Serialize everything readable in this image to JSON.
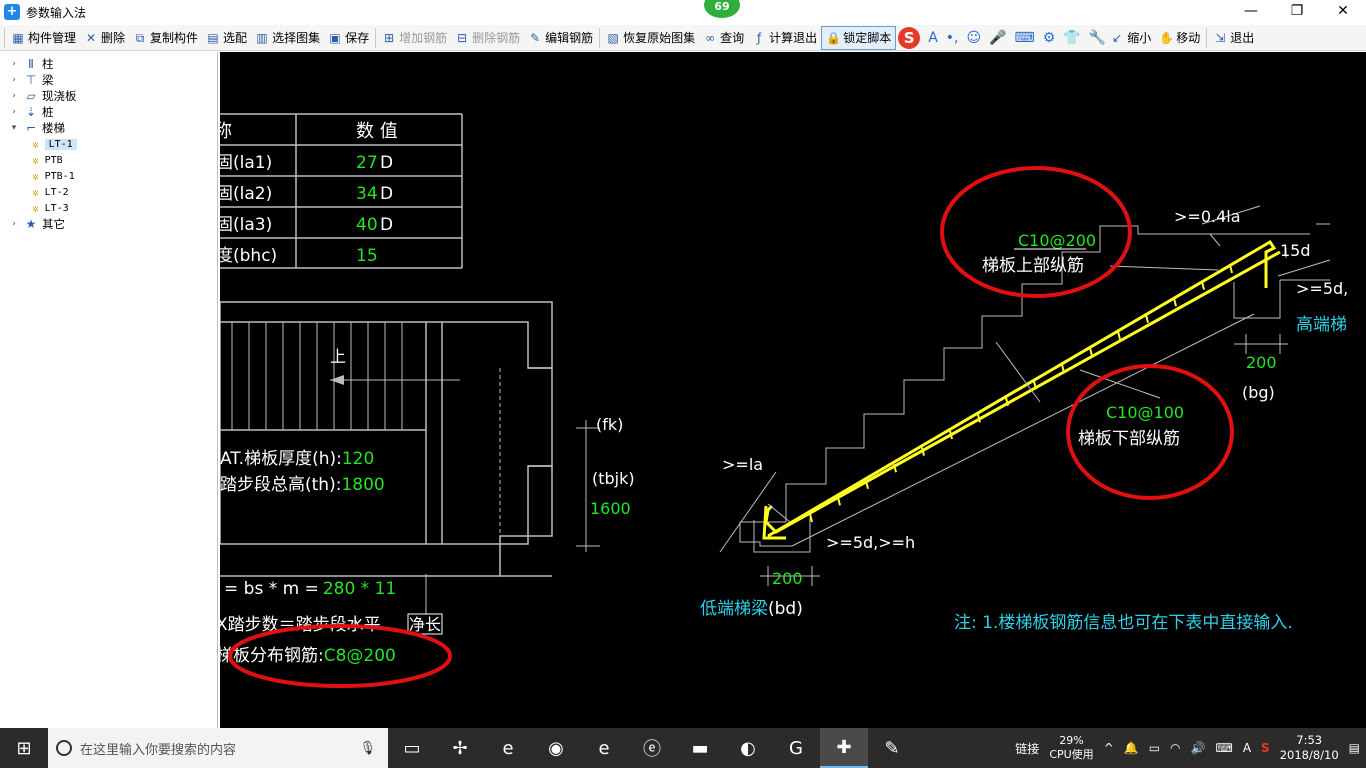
{
  "window": {
    "title": "参数输入法",
    "badge": "69",
    "controls": [
      "—",
      "❐",
      "✕"
    ]
  },
  "toolbar": {
    "items": [
      {
        "label": "构件管理",
        "icon": "table-icon",
        "glyph": "▦",
        "disabled": false
      },
      {
        "label": "删除",
        "icon": "delete-icon",
        "glyph": "✕",
        "disabled": false
      },
      {
        "label": "复制构件",
        "icon": "copy-icon",
        "glyph": "⧉",
        "disabled": false
      },
      {
        "label": "选配",
        "icon": "select-icon",
        "glyph": "▤",
        "disabled": false
      },
      {
        "label": "选择图集",
        "icon": "atlas-icon",
        "glyph": "▥",
        "disabled": false
      },
      {
        "label": "保存",
        "icon": "save-icon",
        "glyph": "▣",
        "disabled": false
      },
      {
        "label": "增加钢筋",
        "icon": "add-rebar-icon",
        "glyph": "⊞",
        "disabled": true
      },
      {
        "label": "删除钢筋",
        "icon": "delete-rebar-icon",
        "glyph": "⊟",
        "disabled": true
      },
      {
        "label": "编辑钢筋",
        "icon": "edit-rebar-icon",
        "glyph": "✎",
        "disabled": false
      },
      {
        "label": "恢复原始图集",
        "icon": "restore-icon",
        "glyph": "▧",
        "disabled": false
      },
      {
        "label": "查询",
        "icon": "binoculars-icon",
        "glyph": "∞",
        "disabled": false
      },
      {
        "label": "计算退出",
        "icon": "fx-icon",
        "glyph": "ƒ",
        "disabled": false
      },
      {
        "label": "锁定脚本",
        "icon": "lock-icon",
        "glyph": "🔒",
        "disabled": false,
        "locked": true
      }
    ],
    "right_items": [
      {
        "label": "缩小",
        "icon": "zoom-out-icon",
        "glyph": "↙"
      },
      {
        "label": "移动",
        "icon": "move-icon",
        "glyph": "✋"
      },
      {
        "label": "退出",
        "icon": "exit-icon",
        "glyph": "⇲"
      }
    ],
    "ime_icons": [
      "S",
      "A",
      "•,",
      "☺",
      "🎤",
      "⌨",
      "⚙",
      "👕",
      "🔧"
    ]
  },
  "tree": {
    "items": [
      {
        "label": "柱",
        "icon": "column-icon",
        "expanded": false
      },
      {
        "label": "梁",
        "icon": "beam-icon",
        "expanded": false
      },
      {
        "label": "现浇板",
        "icon": "slab-icon",
        "expanded": false
      },
      {
        "label": "桩",
        "icon": "pile-icon",
        "expanded": false
      },
      {
        "label": "楼梯",
        "icon": "stair-icon",
        "expanded": true,
        "children": [
          "LT-1",
          "PTB",
          "PTB-1",
          "LT-2",
          "LT-3"
        ],
        "selected": "LT-1"
      },
      {
        "label": "其它",
        "icon": "star-icon",
        "expanded": false
      }
    ]
  },
  "drawing": {
    "table": {
      "header": [
        "称",
        "数  值"
      ],
      "rows": [
        {
          "name": "固(la1)",
          "value": "27",
          "unit": "D"
        },
        {
          "name": "固(la2)",
          "value": "34",
          "unit": "D"
        },
        {
          "name": "固(la3)",
          "value": "40",
          "unit": "D"
        },
        {
          "name": "度(bhc)",
          "value": "15",
          "unit": ""
        }
      ]
    },
    "plan": {
      "up_label": "上",
      "thickness_label": "AT.梯板厚度(h):",
      "thickness_value": "120",
      "height_label": "踏步段总高(th):",
      "height_value": "1800",
      "fk": "(fk)",
      "tbjk": "(tbjk)",
      "tbjk_value": "1600",
      "formula_prefix": "= bs * m =",
      "formula_value": "280 * 11",
      "steps_label": "X踏步数＝踏步段水平",
      "steps_boxed": "净长",
      "dist_label": "梯板分布钢筋:",
      "dist_value": "C8@200"
    },
    "section": {
      "top_rebar_value": "C10@200",
      "top_rebar_label": "梯板上部纵筋",
      "bottom_rebar_value": "C10@100",
      "bottom_rebar_label": "梯板下部纵筋",
      "la_top": ">=0.4la",
      "d15": "15d",
      "d5": ">=5d,",
      "high_beam": "高端梯",
      "right_200": "200",
      "bg": "(bg)",
      "la_left": ">=la",
      "d5h": ">=5d,>=h",
      "left_200": "200",
      "low_beam": "低端梯梁",
      "bd": "(bd)",
      "note": "注: 1.楼梯板钢筋信息也可在下表中直接输入."
    },
    "colors": {
      "green": "#22e622",
      "cyan": "#2fd0e8",
      "yellow": "#ffff22",
      "red": "#e01010",
      "white": "#ffffff",
      "grey": "#bdbdbd"
    }
  },
  "taskbar": {
    "search_placeholder": "在这里输入你要搜索的内容",
    "apps": [
      "task-view-icon",
      "fan-icon",
      "ie-icon",
      "chrome-icon",
      "edge-icon",
      "ie2-icon",
      "folder-icon",
      "360-icon",
      "sogou-browser-icon",
      "glodon-icon",
      "notes-icon"
    ],
    "tray_label": "链接",
    "cpu_percent": "29%",
    "cpu_label": "CPU使用",
    "ime_label": "A",
    "time": "7:53",
    "date": "2018/8/10"
  }
}
